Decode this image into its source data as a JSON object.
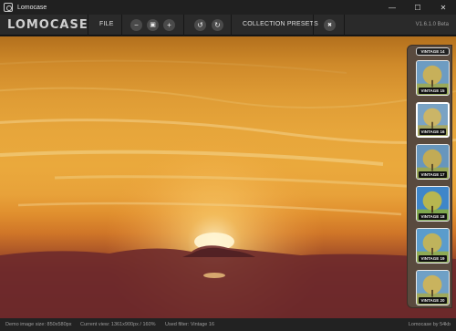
{
  "window": {
    "title": "Lomocase",
    "minimize": "—",
    "maximize": "☐",
    "close": "✕"
  },
  "toolbar": {
    "logo": "LOMOCASE",
    "file_label": "FILE",
    "zoom_out": "−",
    "fit": "▣",
    "zoom_in": "+",
    "rotate_left": "↺",
    "rotate_right": "↻",
    "collection_presets_label": "COLLECTION PRESETS",
    "clear": "✖",
    "version": "V1.6.1.0 Beta"
  },
  "presets": [
    {
      "label": "VINTAGE 14"
    },
    {
      "label": "VINTAGE 15"
    },
    {
      "label": "VINTAGE 16"
    },
    {
      "label": "VINTAGE 17"
    },
    {
      "label": "VINTAGE 18"
    },
    {
      "label": "VINTAGE 19"
    },
    {
      "label": "VINTAGE 20"
    }
  ],
  "status": {
    "demo_size": "Demo image size: 850x580px",
    "current_view": "Current view: 1361x900px / 160%",
    "used_filter": "Used filter: Vintage 16",
    "app_size": "Lomocase by 54kb"
  },
  "colors": {
    "accent_panel": "#594a3e",
    "toolbar": "#2a2a2a",
    "titlebar": "#202020"
  }
}
